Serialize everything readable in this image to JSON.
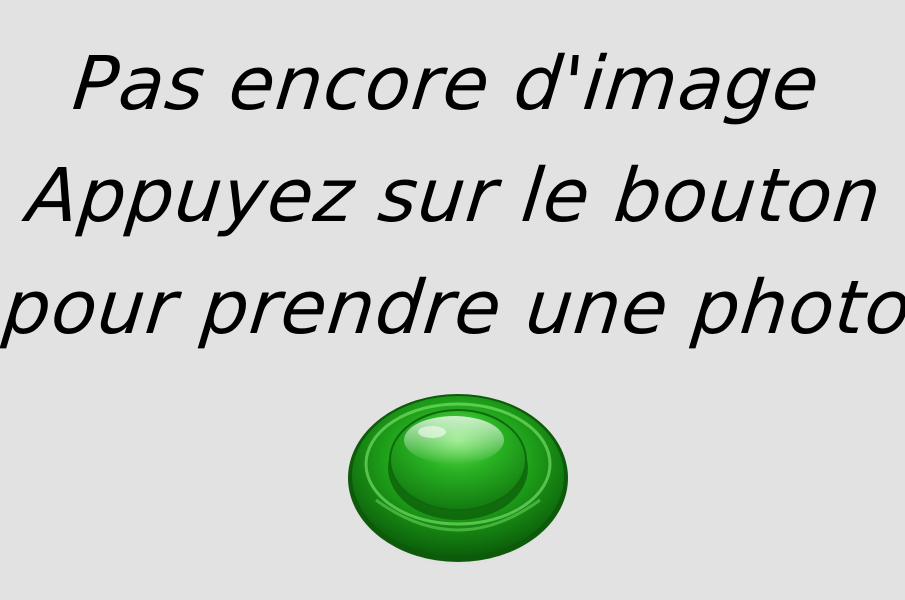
{
  "message": {
    "line1": "Pas encore d'image",
    "line2": "Appuyez sur le bouton",
    "line3": "pour prendre une photo"
  },
  "capture_button": {
    "icon": "round-green-push-button",
    "color": "#2db52d"
  },
  "colors": {
    "background": "#e2e2e2",
    "text": "#000000"
  }
}
